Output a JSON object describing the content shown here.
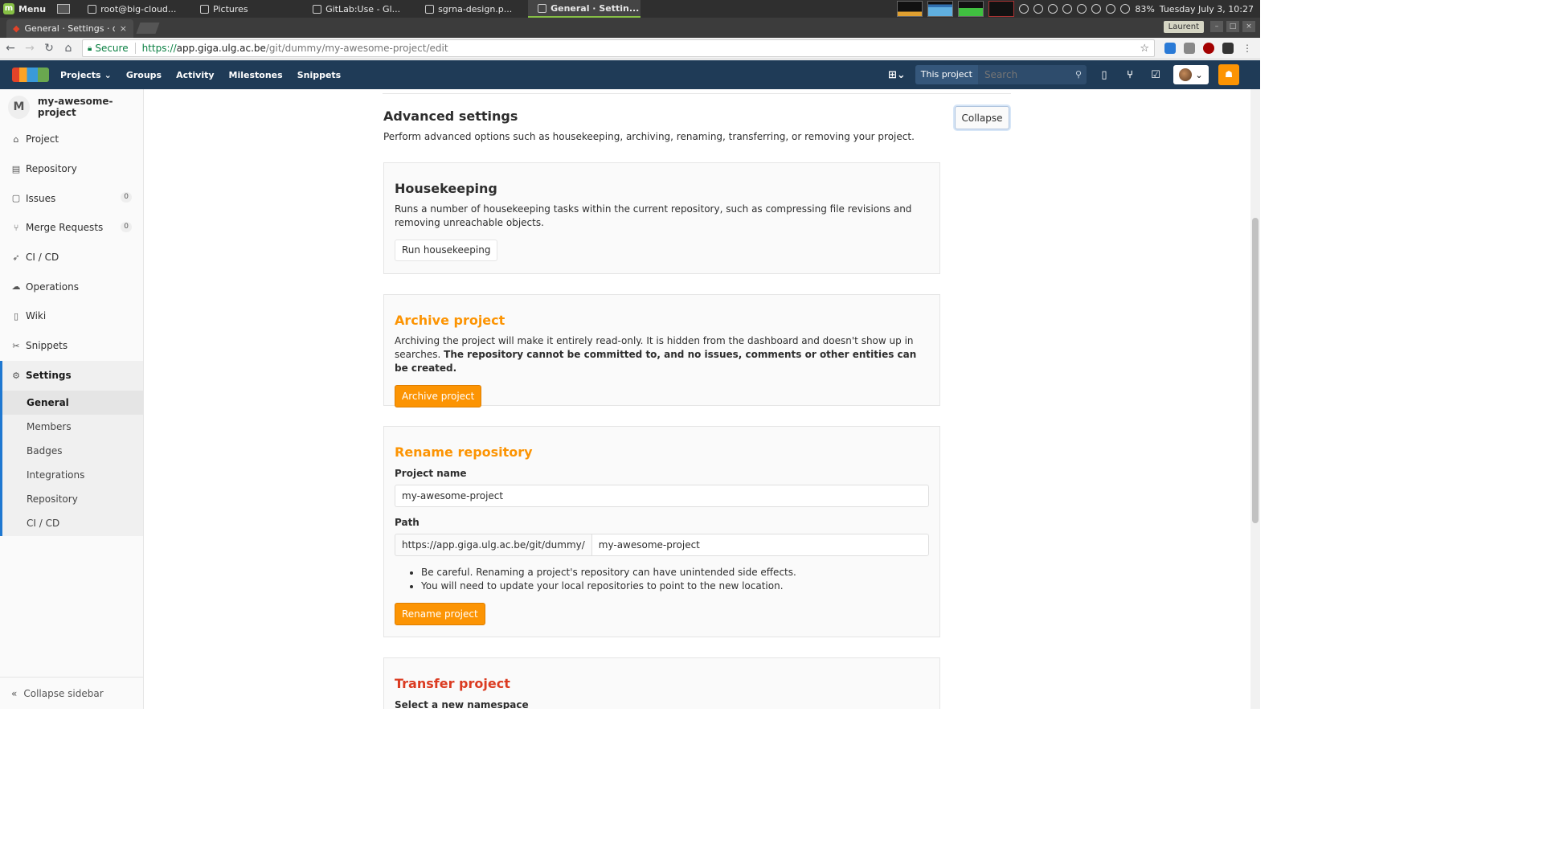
{
  "os": {
    "menu_label": "Menu",
    "tasks": [
      {
        "label": "root@big-cloud..."
      },
      {
        "label": "Pictures"
      },
      {
        "label": "GitLab:Use - Gl..."
      },
      {
        "label": "sgrna-design.p..."
      },
      {
        "label": "General · Settin..."
      }
    ],
    "battery": "83%",
    "clock": "Tuesday July  3, 10:27"
  },
  "browser": {
    "tab_title": "General · Settings · dum",
    "tab_close": "×",
    "profile_name": "Laurent",
    "secure_label": "Secure",
    "url_scheme": "https://",
    "url_host": "app.giga.ulg.ac.be",
    "url_path": "/git/dummy/my-awesome-project/edit"
  },
  "gitlab_nav": {
    "links": [
      "Projects",
      "Groups",
      "Activity",
      "Milestones",
      "Snippets"
    ],
    "search_scope": "This project",
    "search_placeholder": "Search"
  },
  "sidebar": {
    "project_initial": "M",
    "project_name": "my-awesome-project",
    "items": [
      {
        "label": "Project",
        "icon": "home-icon"
      },
      {
        "label": "Repository",
        "icon": "doc-icon"
      },
      {
        "label": "Issues",
        "icon": "issues-icon",
        "count": "0"
      },
      {
        "label": "Merge Requests",
        "icon": "merge-icon",
        "count": "0"
      },
      {
        "label": "CI / CD",
        "icon": "rocket-icon"
      },
      {
        "label": "Operations",
        "icon": "cloud-icon"
      },
      {
        "label": "Wiki",
        "icon": "book-icon"
      },
      {
        "label": "Snippets",
        "icon": "scissors-icon"
      },
      {
        "label": "Settings",
        "icon": "gear-icon"
      }
    ],
    "sub_items": [
      "General",
      "Members",
      "Badges",
      "Integrations",
      "Repository",
      "CI / CD"
    ],
    "collapse_label": "Collapse sidebar"
  },
  "main": {
    "section_title": "Advanced settings",
    "section_desc": "Perform advanced options such as housekeeping, archiving, renaming, transferring, or removing your project.",
    "collapse_button": "Collapse",
    "housekeeping": {
      "title": "Housekeeping",
      "text": "Runs a number of housekeeping tasks within the current repository, such as compressing file revisions and removing unreachable objects.",
      "button": "Run housekeeping"
    },
    "archive": {
      "title": "Archive project",
      "text": "Archiving the project will make it entirely read-only. It is hidden from the dashboard and doesn't show up in searches.",
      "text_bold": "The repository cannot be committed to, and no issues, comments or other entities can be created.",
      "button": "Archive project"
    },
    "rename": {
      "title": "Rename repository",
      "name_label": "Project name",
      "name_value": "my-awesome-project",
      "path_label": "Path",
      "path_prefix": "https://app.giga.ulg.ac.be/git/dummy/",
      "path_value": "my-awesome-project",
      "bullets": [
        "Be careful. Renaming a project's repository can have unintended side effects.",
        "You will need to update your local repositories to point to the new location."
      ],
      "button": "Rename project"
    },
    "transfer": {
      "title": "Transfer project",
      "namespace_label": "Select a new namespace"
    }
  }
}
